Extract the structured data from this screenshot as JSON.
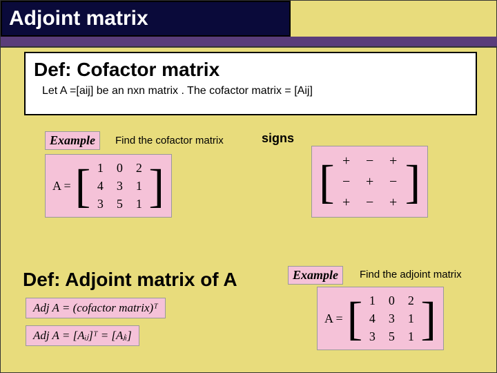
{
  "title": "Adjoint matrix",
  "def1": {
    "heading": "Def:  Cofactor matrix",
    "body": "Let A =[aij]  be an nxn matrix . The  cofactor matrix  =  [Aij]"
  },
  "example_label": "Example",
  "find1": "Find  the cofactor matrix",
  "matrixA": {
    "prefix": "A =",
    "r1c1": "1",
    "r1c2": "0",
    "r1c3": "2",
    "r2c1": "4",
    "r2c2": "3",
    "r2c3": "1",
    "r3c1": "3",
    "r3c2": "5",
    "r3c3": "1"
  },
  "signs_label": "signs",
  "signs": {
    "r1c1": "+",
    "r1c2": "−",
    "r1c3": "+",
    "r2c1": "−",
    "r2c2": "+",
    "r2c3": "−",
    "r3c1": "+",
    "r3c2": "−",
    "r3c3": "+"
  },
  "def2": {
    "heading": "Def:  Adjoint matrix of A"
  },
  "adj1_html": "Adj A = (cofactor matrix)ᵀ",
  "adj2_html": "Adj A = [Aᵢⱼ]ᵀ = [Aⱼᵢ]",
  "find2": "Find  the adjoint matrix"
}
